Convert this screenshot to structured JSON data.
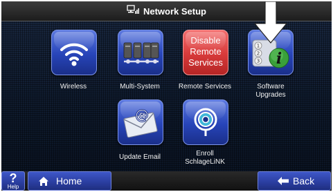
{
  "header": {
    "title": "Network Setup",
    "icon": "network-icon"
  },
  "tiles": {
    "wireless": {
      "label": "Wireless",
      "icon": "wifi-icon"
    },
    "multi_system": {
      "label": "Multi-System",
      "icon": "multi-system-icon"
    },
    "remote_services": {
      "label": "Remote Services",
      "tile_text": "Disable\nRemote\nServices"
    },
    "software_upgrades": {
      "label": "Software\nUpgrades",
      "icon": "software-info-icon"
    },
    "update_email": {
      "label": "Update Email",
      "icon": "email-icon"
    },
    "enroll": {
      "label": "Enroll\nSchlageLiNK",
      "icon": "schlagelink-icon"
    }
  },
  "footer": {
    "help_mark": "?",
    "help_label": "Help",
    "home_label": "Home",
    "back_label": "Back"
  },
  "colors": {
    "tile_blue": "#2f4fc4",
    "tile_red": "#d93b3b",
    "background": "#0d1626"
  }
}
